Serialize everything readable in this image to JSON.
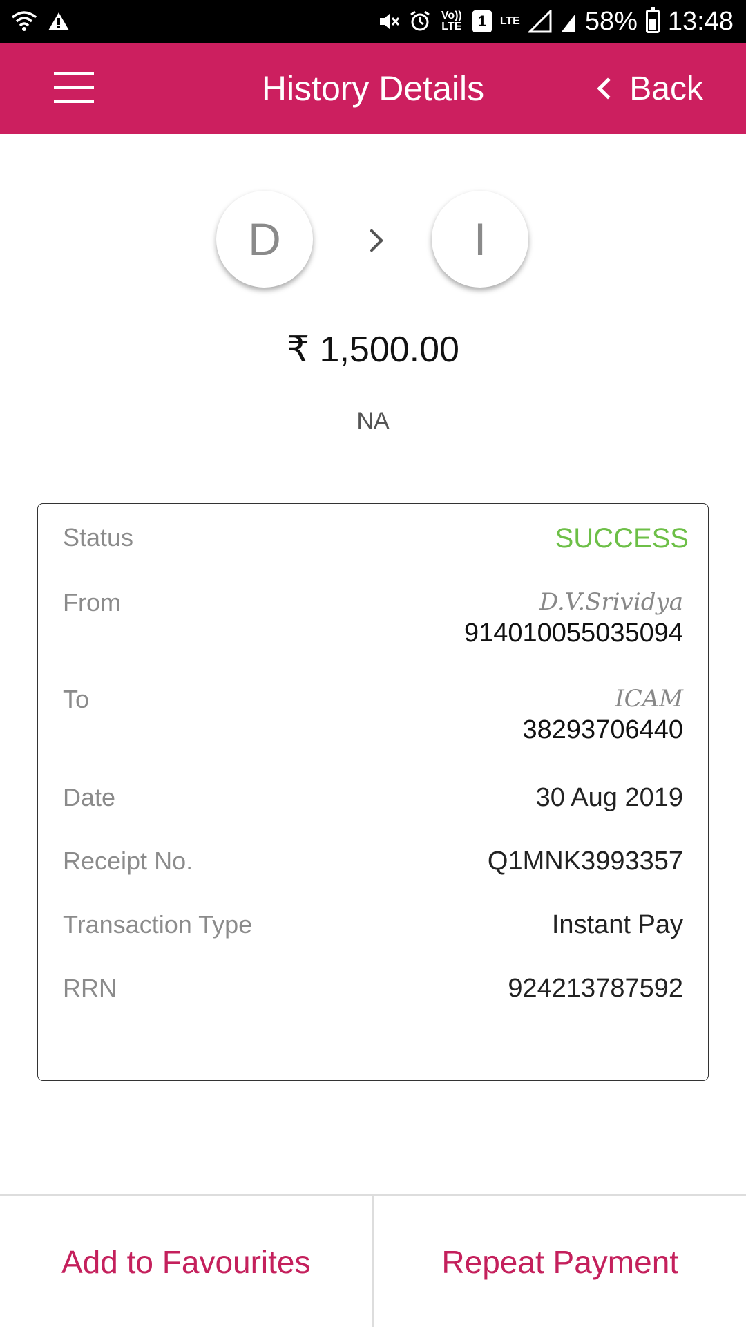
{
  "status_bar": {
    "icons": [
      "wifi-icon",
      "warning-icon",
      "mute-icon",
      "alarm-icon",
      "volte-icon",
      "sim-icon",
      "lte-signal-icon",
      "signal-icon",
      "battery-icon"
    ],
    "volte_label": "Vo)) LTE",
    "sim_label": "1",
    "lte_label": "LTE",
    "battery_percent": "58%",
    "time": "13:48"
  },
  "header": {
    "title": "History Details",
    "back_label": "Back",
    "background_color": "#cc1f5f"
  },
  "transfer": {
    "from_initial": "D",
    "to_initial": "I",
    "amount": "₹ 1,500.00",
    "remark": "NA"
  },
  "details": {
    "status_label": "Status",
    "status_value": "SUCCESS",
    "status_color": "#6dbf47",
    "from_label": "From",
    "from_name": "D.V.Srividya",
    "from_account": "914010055035094",
    "to_label": "To",
    "to_name": "ICAM",
    "to_account": "38293706440",
    "date_label": "Date",
    "date_value": "30 Aug 2019",
    "receipt_label": "Receipt No.",
    "receipt_value": "Q1MNK3993357",
    "type_label": "Transaction Type",
    "type_value": "Instant Pay",
    "rrn_label": "RRN",
    "rrn_value": "924213787592"
  },
  "actions": {
    "favourites_label": "Add to Favourites",
    "repeat_label": "Repeat Payment",
    "accent_color": "#c4205c"
  }
}
